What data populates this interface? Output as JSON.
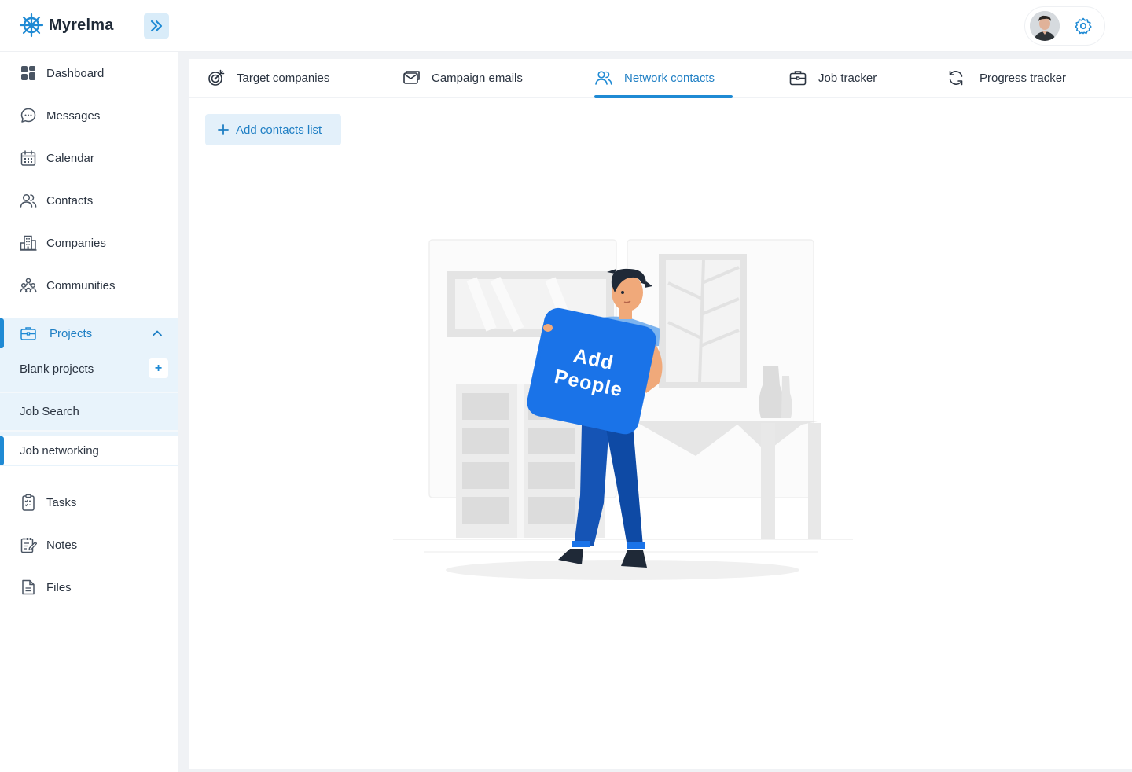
{
  "app": {
    "name": "Myrelma"
  },
  "colors": {
    "accent": "#1f8ad4",
    "accent_light": "#e3f0fa",
    "illustration_blue": "#1a73e8"
  },
  "sidebar": {
    "items": [
      {
        "label": "Dashboard",
        "icon": "dashboard-icon"
      },
      {
        "label": "Messages",
        "icon": "chat-bubble-icon"
      },
      {
        "label": "Calendar",
        "icon": "calendar-icon"
      },
      {
        "label": "Contacts",
        "icon": "people-icon"
      },
      {
        "label": "Companies",
        "icon": "building-icon"
      },
      {
        "label": "Communities",
        "icon": "community-icon"
      }
    ],
    "projects": {
      "label": "Projects",
      "icon": "briefcase-icon",
      "expanded": true,
      "sub_items": [
        {
          "label": "Blank projects"
        },
        {
          "label": "Job Search"
        },
        {
          "label": "Job networking",
          "active": true
        }
      ]
    },
    "bottom_items": [
      {
        "label": "Tasks",
        "icon": "clipboard-check-icon"
      },
      {
        "label": "Notes",
        "icon": "notes-icon"
      },
      {
        "label": "Files",
        "icon": "file-icon"
      }
    ]
  },
  "tabs": [
    {
      "label": "Target companies",
      "icon": "target-icon"
    },
    {
      "label": "Campaign emails",
      "icon": "email-icon"
    },
    {
      "label": "Network contacts",
      "icon": "people-icon",
      "active": true
    },
    {
      "label": "Job tracker",
      "icon": "briefcase-icon"
    },
    {
      "label": "Progress tracker",
      "icon": "refresh-icon"
    }
  ],
  "main": {
    "add_button_label": "Add contacts list",
    "illustration_text_line1": "Add",
    "illustration_text_line2": "People"
  }
}
